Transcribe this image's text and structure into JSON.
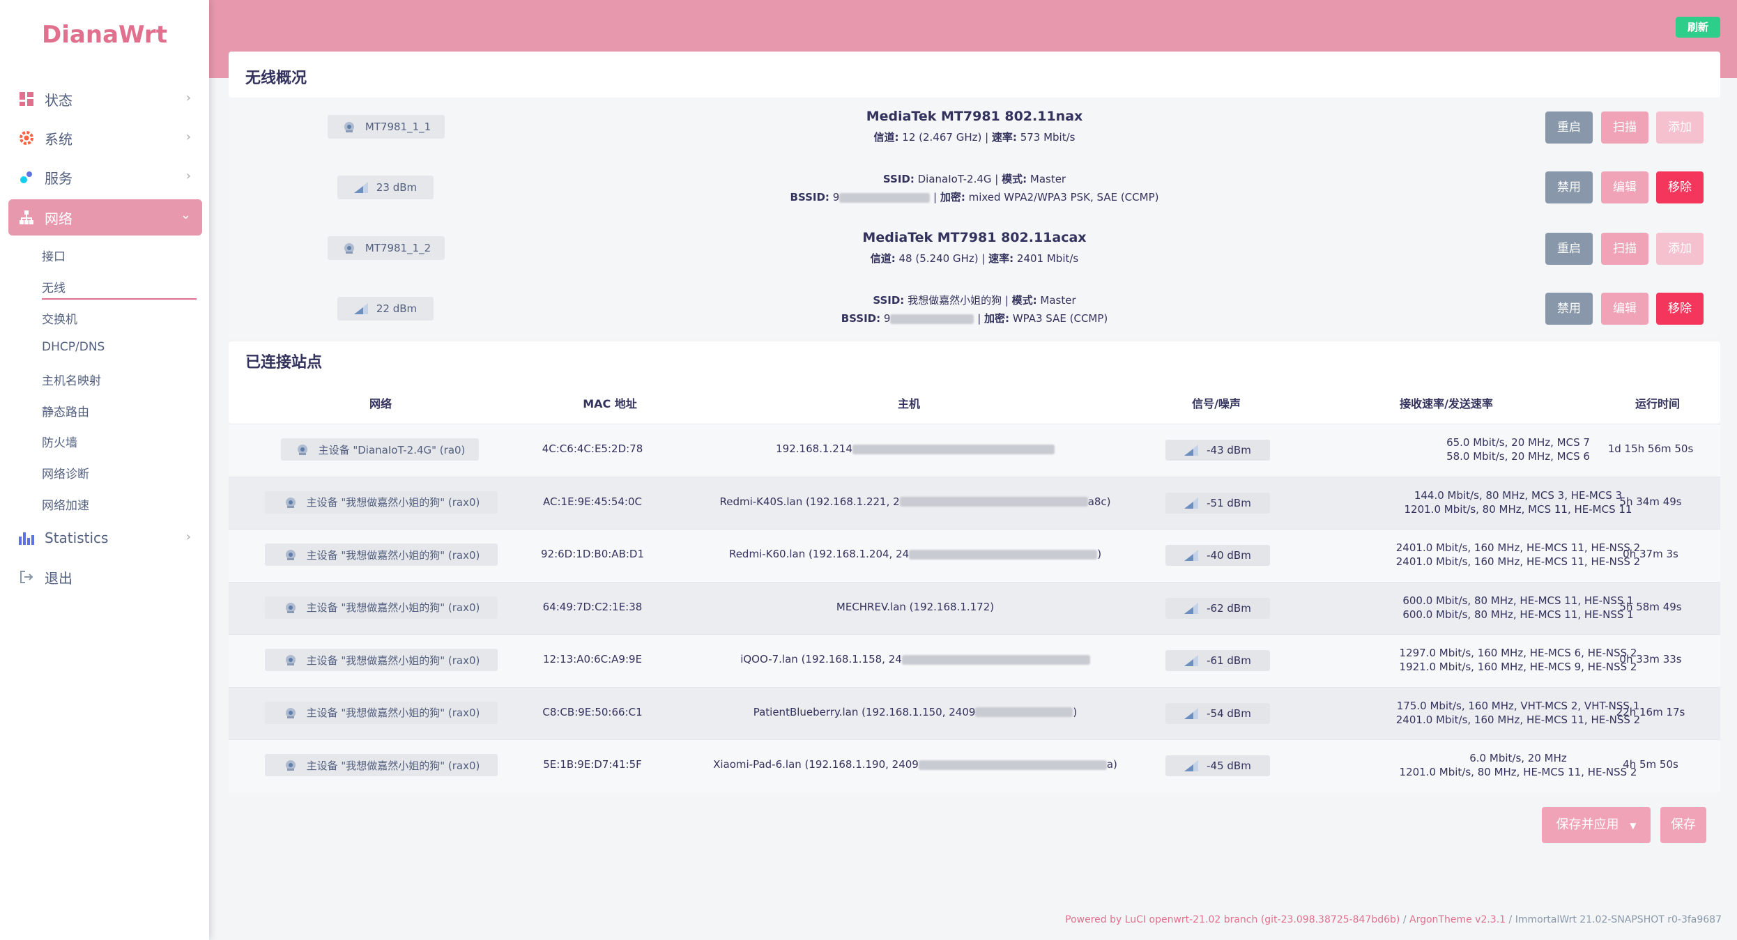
{
  "brand": "DianaWrt",
  "menu": {
    "status": "状态",
    "system": "系统",
    "services": "服务",
    "network": "网络",
    "statistics": "Statistics",
    "logout": "退出"
  },
  "submenu": [
    "接口",
    "无线",
    "交换机",
    "DHCP/DNS",
    "主机名映射",
    "静态路由",
    "防火墙",
    "网络诊断",
    "网络加速"
  ],
  "header": {
    "refresh": "刷新"
  },
  "wireless": {
    "title": "无线概况",
    "devices": [
      {
        "name": "MT7981_1_1",
        "title": "MediaTek MT7981 802.11nax",
        "info_label1": "信道:",
        "info_value1": " 12 (2.467 GHz) | ",
        "info_label2": "速率:",
        "info_value2": " 573 Mbit/s",
        "buttons": [
          "重启",
          "扫描",
          "添加"
        ]
      },
      {
        "name": "MT7981_1_2",
        "title": "MediaTek MT7981 802.11acax",
        "info_label1": "信道:",
        "info_value1": " 48 (5.240 GHz) | ",
        "info_label2": "速率:",
        "info_value2": " 2401 Mbit/s",
        "buttons": [
          "重启",
          "扫描",
          "添加"
        ]
      }
    ],
    "networks": [
      {
        "signal": "23 dBm",
        "ssid_label": "SSID:",
        "ssid": " DianaIoT-2.4G | ",
        "mode_label": "模式:",
        "mode": " Master",
        "bssid_label": "BSSID:",
        "bssid_prefix": " 9",
        "enc_label": "加密:",
        "enc": " mixed WPA2/WPA3 PSK, SAE (CCMP)",
        "buttons": [
          "禁用",
          "编辑",
          "移除"
        ]
      },
      {
        "signal": "22 dBm",
        "ssid_label": "SSID:",
        "ssid": " 我想做嘉然小姐的狗 | ",
        "mode_label": "模式:",
        "mode": " Master",
        "bssid_label": "BSSID:",
        "bssid_prefix": " 9",
        "enc_label": "加密:",
        "enc": " WPA3 SAE (CCMP)",
        "buttons": [
          "禁用",
          "编辑",
          "移除"
        ]
      }
    ]
  },
  "stations": {
    "title": "已连接站点",
    "headers": [
      "网络",
      "MAC 地址",
      "主机",
      "信号/噪声",
      "接收速率/发送速率",
      "运行时间"
    ],
    "rows": [
      {
        "network": "主设备 \"DianaIoT-2.4G\" (ra0)",
        "mac": "4C:C6:4C:E5:2D:78",
        "host": "192.168.1.214",
        "host_end": "",
        "signal": "-43 dBm",
        "rx": "65.0 Mbit/s, 20 MHz, MCS 7",
        "tx": "58.0 Mbit/s, 20 MHz, MCS 6",
        "uptime": "1d 15h 56m 50s"
      },
      {
        "network": "主设备 \"我想做嘉然小姐的狗\" (rax0)",
        "mac": "AC:1E:9E:45:54:0C",
        "host": "Redmi-K40S.lan (192.168.1.221, 2",
        "host_end": "a8c)",
        "signal": "-51 dBm",
        "rx": "144.0 Mbit/s, 80 MHz, MCS 3, HE-MCS 3",
        "tx": "1201.0 Mbit/s, 80 MHz, MCS 11, HE-MCS 11",
        "uptime": "5h 34m 49s"
      },
      {
        "network": "主设备 \"我想做嘉然小姐的狗\" (rax0)",
        "mac": "92:6D:1D:B0:AB:D1",
        "host": "Redmi-K60.lan (192.168.1.204, 24",
        "host_end": ")",
        "signal": "-40 dBm",
        "rx": "2401.0 Mbit/s, 160 MHz, HE-MCS 11, HE-NSS 2",
        "tx": "2401.0 Mbit/s, 160 MHz, HE-MCS 11, HE-NSS 2",
        "uptime": "0h 37m 3s"
      },
      {
        "network": "主设备 \"我想做嘉然小姐的狗\" (rax0)",
        "mac": "64:49:7D:C2:1E:38",
        "host": "MECHREV.lan (192.168.1.172)",
        "host_end": "",
        "signal": "-62 dBm",
        "rx": "600.0 Mbit/s, 80 MHz, HE-MCS 11, HE-NSS 1",
        "tx": "600.0 Mbit/s, 80 MHz, HE-MCS 11, HE-NSS 1",
        "uptime": "5h 58m 49s"
      },
      {
        "network": "主设备 \"我想做嘉然小姐的狗\" (rax0)",
        "mac": "12:13:A0:6C:A9:9E",
        "host": "iQOO-7.lan (192.168.1.158, 24",
        "host_end": "",
        "signal": "-61 dBm",
        "rx": "1297.0 Mbit/s, 160 MHz, HE-MCS 6, HE-NSS 2",
        "tx": "1921.0 Mbit/s, 160 MHz, HE-MCS 9, HE-NSS 2",
        "uptime": "0h 33m 33s"
      },
      {
        "network": "主设备 \"我想做嘉然小姐的狗\" (rax0)",
        "mac": "C8:CB:9E:50:66:C1",
        "host": "PatientBlueberry.lan (192.168.1.150, 2409",
        "host_end": ")",
        "signal": "-54 dBm",
        "rx": "175.0 Mbit/s, 160 MHz, VHT-MCS 2, VHT-NSS 1",
        "tx": "2401.0 Mbit/s, 160 MHz, HE-MCS 11, HE-NSS 2",
        "uptime": "22h 16m 17s"
      },
      {
        "network": "主设备 \"我想做嘉然小姐的狗\" (rax0)",
        "mac": "5E:1B:9E:D7:41:5F",
        "host": "Xiaomi-Pad-6.lan (192.168.1.190, 2409",
        "host_end": "a)",
        "signal": "-45 dBm",
        "rx": "6.0 Mbit/s, 20 MHz",
        "tx": "1201.0 Mbit/s, 80 MHz, HE-MCS 11, HE-NSS 2",
        "uptime": "4h 5m 50s"
      }
    ]
  },
  "actions": {
    "save_apply": "保存并应用",
    "save": "保存"
  },
  "footer": {
    "powered": "Powered by LuCI openwrt-21.02 branch (git-23.098.38725-847bd6b)",
    "sep1": " / ",
    "theme": "ArgonTheme v2.3.1",
    "sep2": " / ",
    "build": "ImmortalWrt 21.02-SNAPSHOT r0-3fa9687"
  },
  "colors": {
    "accent": "#e898ad",
    "brand": "#e0708e",
    "success": "#2dce89",
    "danger": "#f5365c",
    "gray_btn": "#8898aa"
  }
}
